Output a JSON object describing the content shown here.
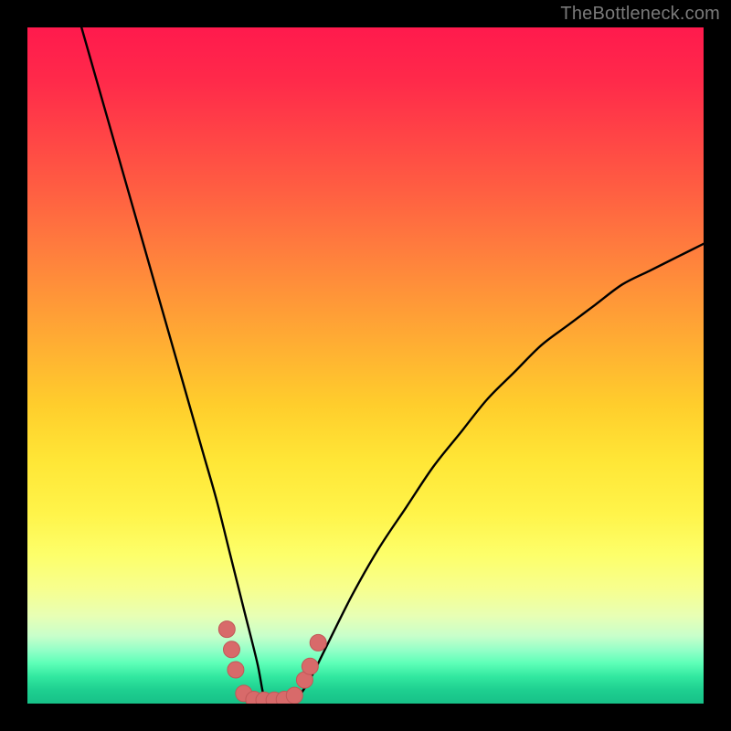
{
  "watermark": "TheBottleneck.com",
  "colors": {
    "background": "#000000",
    "curve_stroke": "#000000",
    "marker_fill": "#d86a6a",
    "marker_stroke": "#c05858",
    "watermark_text": "#7a7a7a"
  },
  "chart_data": {
    "type": "line",
    "title": "",
    "xlabel": "",
    "ylabel": "",
    "xlim": [
      0,
      100
    ],
    "ylim": [
      0,
      100
    ],
    "grid": false,
    "series": [
      {
        "name": "bottleneck-curve",
        "x": [
          8,
          10,
          12,
          14,
          16,
          18,
          20,
          22,
          24,
          26,
          28,
          30,
          32,
          34,
          35,
          36,
          38,
          40,
          42,
          44,
          48,
          52,
          56,
          60,
          64,
          68,
          72,
          76,
          80,
          84,
          88,
          92,
          96,
          100
        ],
        "values": [
          100,
          93,
          86,
          79,
          72,
          65,
          58,
          51,
          44,
          37,
          30,
          22,
          14,
          6,
          1,
          0.5,
          0.5,
          1,
          4,
          8,
          16,
          23,
          29,
          35,
          40,
          45,
          49,
          53,
          56,
          59,
          62,
          64,
          66,
          68
        ]
      }
    ],
    "annotations": [
      {
        "type": "marker-cluster",
        "description": "pink rounded markers near curve minimum",
        "points_xy": [
          [
            29.5,
            11
          ],
          [
            30.2,
            8
          ],
          [
            30.8,
            5
          ],
          [
            32,
            1.5
          ],
          [
            33.5,
            0.6
          ],
          [
            35,
            0.5
          ],
          [
            36.5,
            0.5
          ],
          [
            38,
            0.6
          ],
          [
            39.5,
            1.2
          ],
          [
            41,
            3.5
          ],
          [
            41.8,
            5.5
          ],
          [
            43,
            9
          ]
        ],
        "radius_px": 9
      }
    ]
  }
}
